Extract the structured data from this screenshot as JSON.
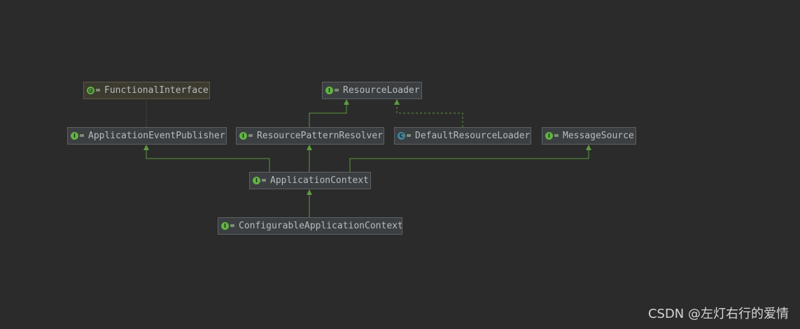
{
  "nodes": {
    "functional_interface": {
      "label": "FunctionalInterface",
      "kind": "annotation",
      "kind_icon": "annotation-icon"
    },
    "resource_loader": {
      "label": "ResourceLoader",
      "kind": "interface",
      "kind_icon": "interface-icon"
    },
    "application_event_publisher": {
      "label": "ApplicationEventPublisher",
      "kind": "interface",
      "kind_icon": "interface-icon"
    },
    "resource_pattern_resolver": {
      "label": "ResourcePatternResolver",
      "kind": "interface",
      "kind_icon": "interface-icon"
    },
    "default_resource_loader": {
      "label": "DefaultResourceLoader",
      "kind": "class",
      "kind_icon": "class-icon"
    },
    "message_source": {
      "label": "MessageSource",
      "kind": "interface",
      "kind_icon": "interface-icon"
    },
    "application_context": {
      "label": "ApplicationContext",
      "kind": "interface",
      "kind_icon": "interface-icon"
    },
    "configurable_application_context": {
      "label": "ConfigurableApplicationContext",
      "kind": "interface",
      "kind_icon": "interface-icon"
    }
  },
  "edges": [
    {
      "from": "resource_pattern_resolver",
      "to": "resource_loader",
      "style": "solid"
    },
    {
      "from": "default_resource_loader",
      "to": "resource_loader",
      "style": "dashed"
    },
    {
      "from": "application_context",
      "to": "application_event_publisher",
      "style": "solid"
    },
    {
      "from": "application_context",
      "to": "resource_pattern_resolver",
      "style": "solid"
    },
    {
      "from": "application_context",
      "to": "message_source",
      "style": "solid"
    },
    {
      "from": "configurable_application_context",
      "to": "application_context",
      "style": "solid"
    },
    {
      "from": "application_event_publisher",
      "to": "functional_interface",
      "style": "dotted"
    }
  ],
  "colors": {
    "background": "#2b2b2b",
    "edge": "#5c9a3e",
    "dotted_edge": "#4f6b45"
  },
  "watermark": "CSDN @左灯右行的爱情"
}
